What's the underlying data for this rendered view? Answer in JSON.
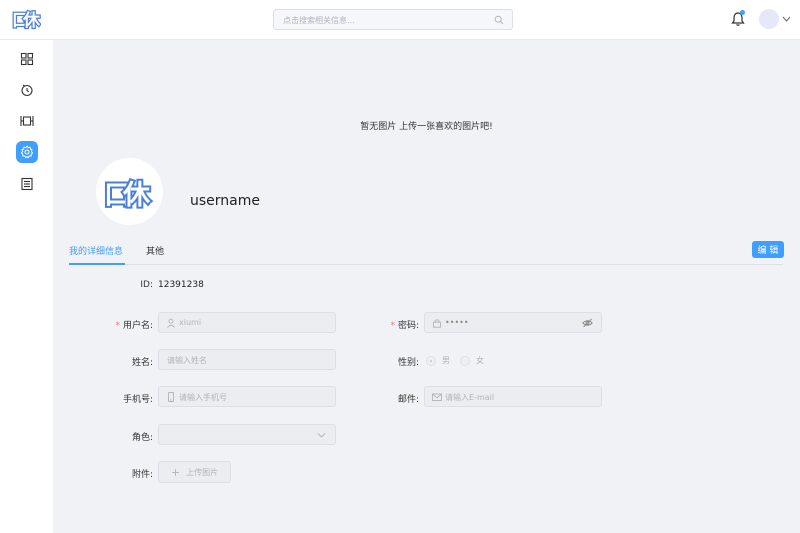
{
  "header": {
    "logo_text": "咻",
    "search_placeholder": "点击搜索相关信息..."
  },
  "sidebar": {
    "items": [
      {
        "icon": "dashboard-icon",
        "active": false
      },
      {
        "icon": "timer-icon",
        "active": false
      },
      {
        "icon": "film-icon",
        "active": false
      },
      {
        "icon": "settings-icon",
        "active": true
      },
      {
        "icon": "document-icon",
        "active": false
      }
    ]
  },
  "profile": {
    "cover_text": "暂无图片 上传一张喜欢的图片吧!",
    "username": "username"
  },
  "tabs": [
    {
      "label": "我的详细信息",
      "active": true
    },
    {
      "label": "其他",
      "active": false
    }
  ],
  "edit_label": "编 辑",
  "form": {
    "id_label": "ID:",
    "id_value": "12391238",
    "username_label": "用户名:",
    "username_placeholder": "xiumi",
    "password_label": "密码:",
    "password_value": "•••••",
    "name_label": "姓名:",
    "name_placeholder": "请输入姓名",
    "gender_label": "性别:",
    "gender_options": [
      "男",
      "女"
    ],
    "gender_selected": "男",
    "phone_label": "手机号:",
    "phone_placeholder": "请输入手机号",
    "email_label": "邮件:",
    "email_placeholder": "请输入E-mail",
    "role_label": "角色:",
    "attachment_label": "附件:",
    "upload_label": "上传图片",
    "required_mark": "*"
  },
  "colors": {
    "primary": "#409eff",
    "required": "#f56c6c",
    "background": "#f0f2f5"
  }
}
